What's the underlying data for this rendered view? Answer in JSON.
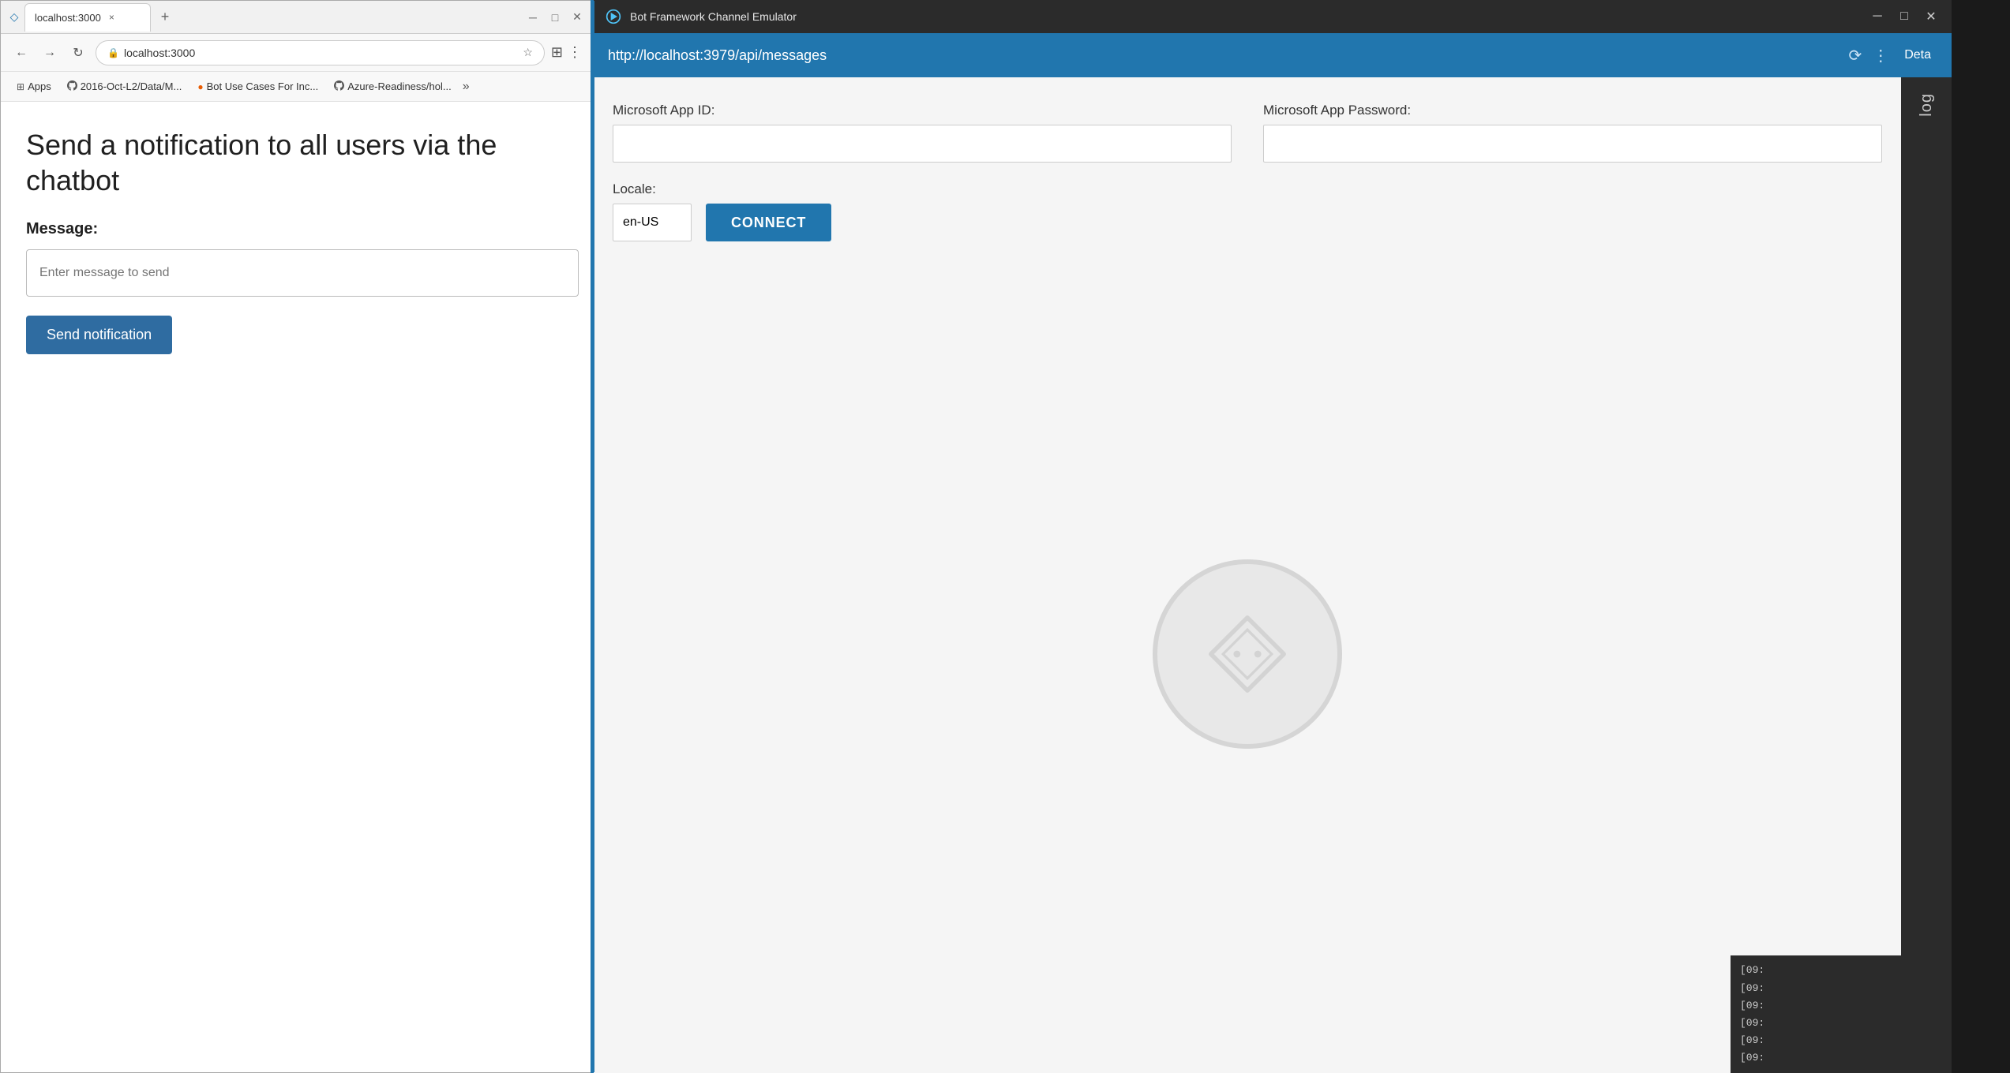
{
  "browser": {
    "tab": {
      "favicon": "◇",
      "title": "localhost:3000",
      "close": "×"
    },
    "address": "localhost:3000",
    "bookmarks": [
      {
        "icon": "grid",
        "label": "Apps"
      },
      {
        "icon": "github",
        "label": "2016-Oct-L2/Data/M..."
      },
      {
        "icon": "circle-o",
        "label": "Bot Use Cases For Inc..."
      },
      {
        "icon": "github",
        "label": "Azure-Readiness/hol..."
      }
    ],
    "page": {
      "heading": "Send a notification to all users via the\nchatbot",
      "message_label": "Message:",
      "message_placeholder": "Enter message to send",
      "send_button": "Send notification"
    }
  },
  "emulator": {
    "title": "Bot Framework Channel Emulator",
    "url": "http://localhost:3979/api/messages",
    "details_label": "Deta",
    "form": {
      "app_id_label": "Microsoft App ID:",
      "app_id_value": "",
      "app_password_label": "Microsoft App Password:",
      "app_password_value": "",
      "locale_label": "Locale:",
      "locale_value": "en-US",
      "connect_button": "CONNECT"
    },
    "log_tab": "log",
    "log_lines": [
      "[09:",
      "[09:",
      "[09:",
      "[09:",
      "[09:",
      "[09:"
    ]
  }
}
